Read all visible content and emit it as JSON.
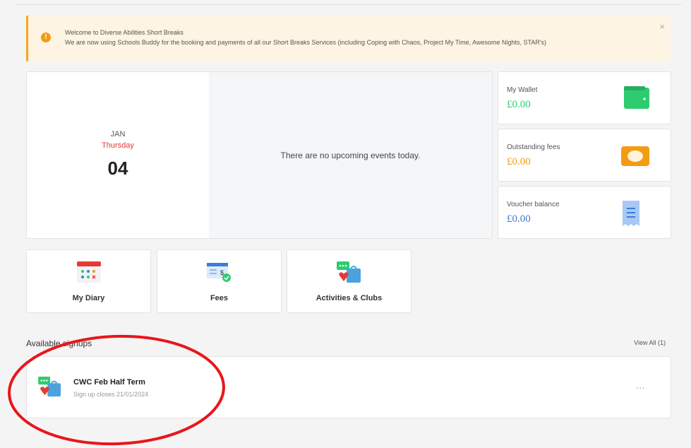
{
  "banner": {
    "title": "Welcome to Diverse Abilities Short Breaks",
    "text": "We are now using Schools Buddy for the booking and payments of all our Short Breaks Services (including Coping with Chaos, Project My Time, Awesome Nights, STAR's)",
    "close": "×",
    "accent": "#f5a623"
  },
  "calendar": {
    "month": "JAN",
    "weekday": "Thursday",
    "date": "04",
    "no_events": "There are no upcoming events today."
  },
  "wallet": {
    "my_wallet": {
      "label": "My Wallet",
      "amount": "£0.00",
      "color": "#2ecc71",
      "icon": "wallet-icon"
    },
    "outstanding": {
      "label": "Outstanding fees",
      "amount": "£0.00",
      "color": "#f39c12",
      "icon": "cash-icon"
    },
    "voucher": {
      "label": "Voucher balance",
      "amount": "£0.00",
      "color": "#3b7dd8",
      "icon": "receipt-icon"
    }
  },
  "tiles": [
    {
      "label": "My Diary",
      "icon": "calendar-icon"
    },
    {
      "label": "Fees",
      "icon": "fees-icon"
    },
    {
      "label": "Activities & Clubs",
      "icon": "activities-icon"
    }
  ],
  "signups": {
    "title": "Available signups",
    "view_all": "View All (1)",
    "items": [
      {
        "title": "CWC Feb Half Term",
        "subtitle": "Sign up closes 21/01/2024",
        "more": "..."
      }
    ]
  }
}
